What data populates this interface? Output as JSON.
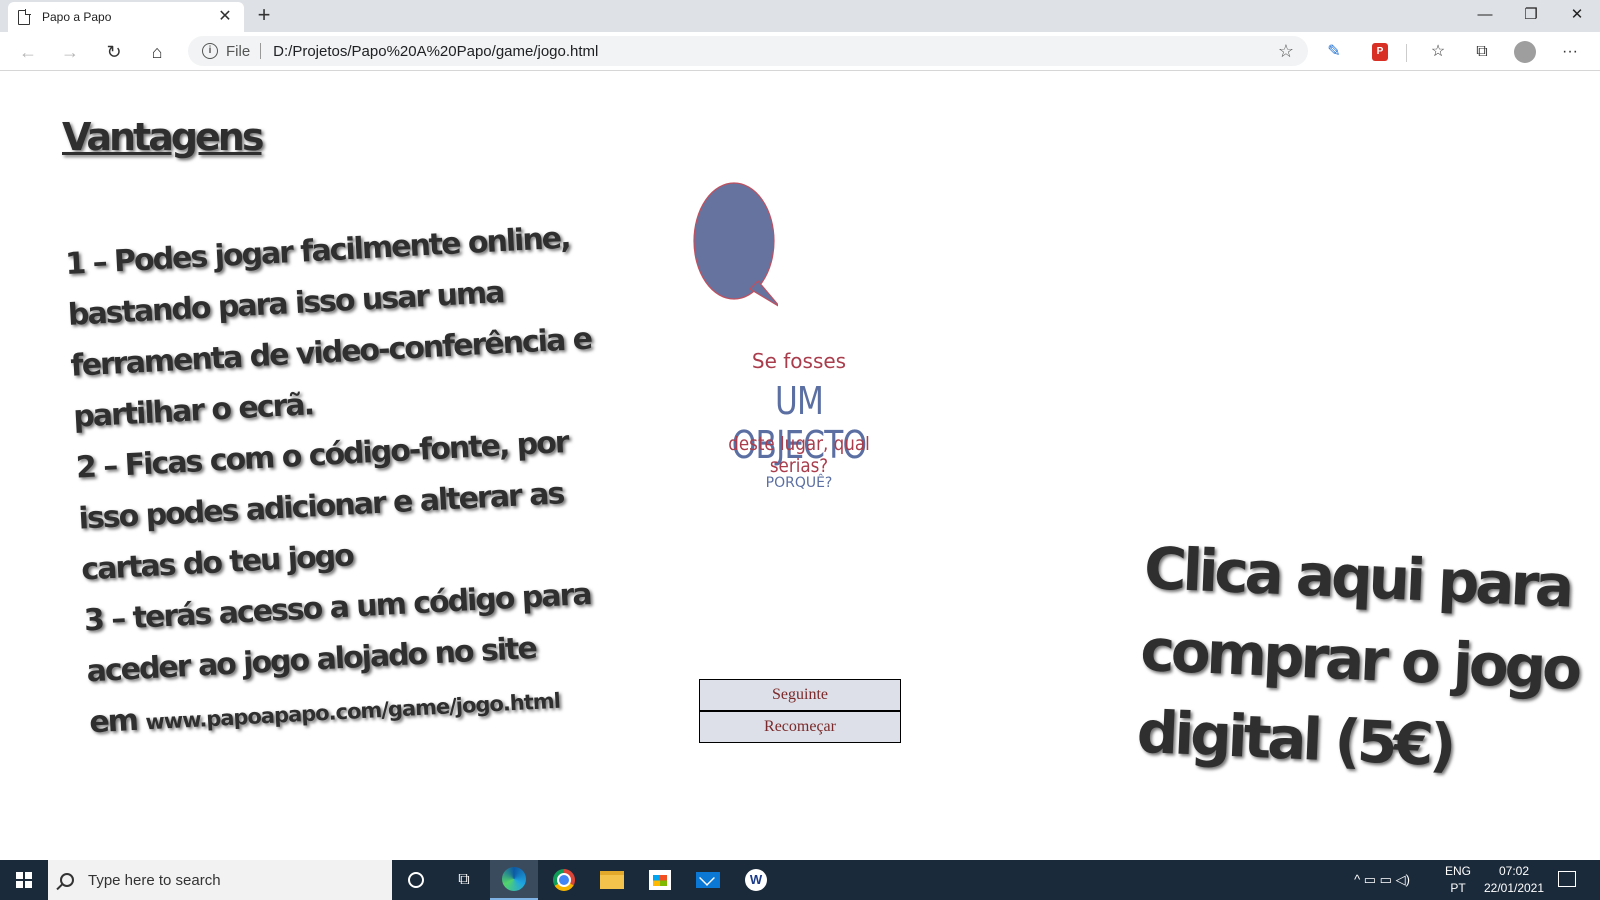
{
  "browser": {
    "tab_title": "Papo a Papo",
    "tab_close": "✕",
    "new_tab": "+",
    "window_controls": {
      "minimize": "—",
      "restore": "❐",
      "close": "✕"
    },
    "nav": {
      "back": "←",
      "forward": "→",
      "refresh": "↻",
      "home": "⌂"
    },
    "address": {
      "info_icon": "i",
      "scheme_label": "File",
      "url": "D:/Projetos/Papo%20A%20Papo/game/jogo.html",
      "favorite_icon": "☆"
    },
    "toolbar_icons": {
      "ext1": "✎",
      "ext_pdf": "P",
      "favorites": "☆",
      "collections": "⧉",
      "menu": "···"
    }
  },
  "page": {
    "heading": "Vantagens",
    "advantages": {
      "line1": "1 – Podes jogar facilmente online,",
      "line2": "bastando para isso usar uma",
      "line3": "ferramenta de video-conferência e",
      "line4": "partilhar o ecrã.",
      "line5": "2 – Ficas com o código-fonte, por",
      "line6": "isso podes adicionar e alterar as",
      "line7": "cartas do teu jogo",
      "line8": "3 – terás acesso a um código para",
      "line9": "aceder ao jogo alojado no site",
      "line10_prefix": "em ",
      "line10_url": "www.papoapapo.com/game/jogo.html"
    },
    "card": {
      "line1": "Se fosses",
      "line2": "UM OBJECTO",
      "line3": "deste lugar, qual serias?",
      "line4": "PORQUÊ?",
      "bubble_fill": "#66739f",
      "bubble_stroke": "#c0505f"
    },
    "buttons": {
      "next": "Seguinte",
      "restart": "Recomeçar"
    },
    "buy": {
      "line1": "Clica aqui para",
      "line2": "comprar o jogo",
      "line3": "digital (5€)"
    }
  },
  "taskbar": {
    "search_placeholder": "Type here to search",
    "lang_top": "ENG",
    "lang_bottom": "PT",
    "time": "07:02",
    "date": "22/01/2021",
    "tray_icons": "^ ▭ ▭ ◁)"
  }
}
